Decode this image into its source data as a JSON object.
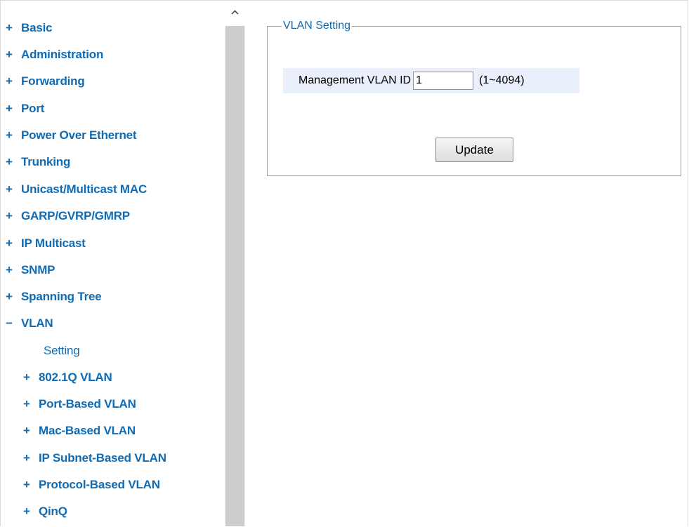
{
  "colors": {
    "nav_link": "#0f6bb3",
    "legend": "#0f6bb3",
    "row_highlight": "#eaf0fb",
    "scrollbar_track": "#f0f0f0",
    "scrollbar_thumb": "#cdcdcd"
  },
  "sidebar": {
    "items": [
      {
        "sign": "+",
        "label": "Basic"
      },
      {
        "sign": "+",
        "label": "Administration"
      },
      {
        "sign": "+",
        "label": "Forwarding"
      },
      {
        "sign": "+",
        "label": "Port"
      },
      {
        "sign": "+",
        "label": "Power Over Ethernet"
      },
      {
        "sign": "+",
        "label": "Trunking"
      },
      {
        "sign": "+",
        "label": "Unicast/Multicast MAC"
      },
      {
        "sign": "+",
        "label": "GARP/GVRP/GMRP"
      },
      {
        "sign": "+",
        "label": "IP Multicast"
      },
      {
        "sign": "+",
        "label": "SNMP"
      },
      {
        "sign": "+",
        "label": "Spanning Tree"
      },
      {
        "sign": "−",
        "label": "VLAN"
      }
    ],
    "vlan_children": {
      "setting": "Setting",
      "items": [
        {
          "sign": "+",
          "label": "802.1Q VLAN"
        },
        {
          "sign": "+",
          "label": "Port-Based VLAN"
        },
        {
          "sign": "+",
          "label": "Mac-Based VLAN"
        },
        {
          "sign": "+",
          "label": "IP Subnet-Based VLAN"
        },
        {
          "sign": "+",
          "label": "Protocol-Based VLAN"
        },
        {
          "sign": "+",
          "label": "QinQ"
        }
      ]
    }
  },
  "scrollbar": {
    "up_icon": "chevron-up-icon"
  },
  "vlan_setting": {
    "legend": "VLAN Setting",
    "management_label": "Management VLAN ID",
    "management_value": "1",
    "range_hint": "(1~4094)",
    "update_label": "Update"
  }
}
